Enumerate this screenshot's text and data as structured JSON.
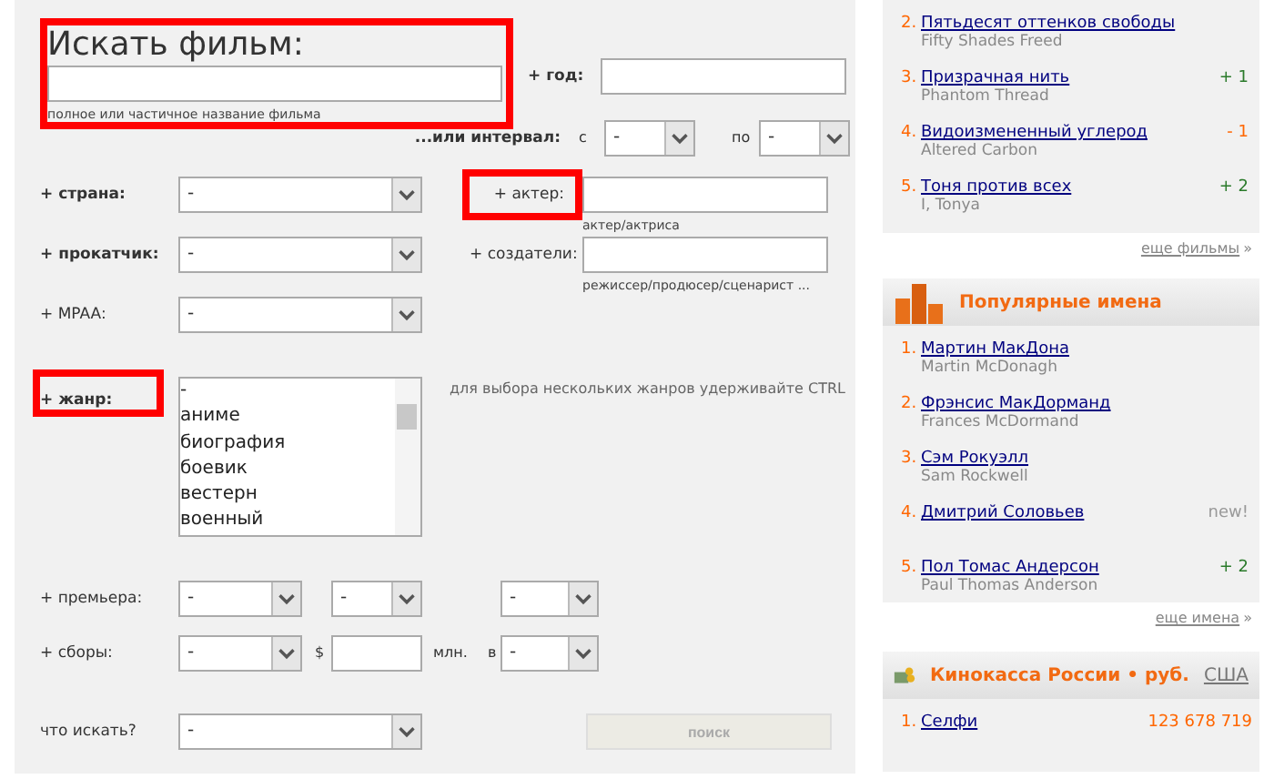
{
  "search": {
    "title": "Искать фильм:",
    "title_highlighted": true,
    "hint": "полное или частичное название фильма",
    "year_label": "+ год:",
    "interval_label": "...или интервал:",
    "from_label": "с",
    "from_value": "-",
    "to_label": "по",
    "to_value": "-"
  },
  "fields": [
    {
      "label": "+ страна:",
      "bold": true,
      "value": "-",
      "side_label": "+ актер:",
      "side_highlighted": true,
      "side_hint": "актер/актриса"
    },
    {
      "label": "+ прокатчик:",
      "bold": true,
      "value": "-",
      "side_label": "+ создатели:",
      "side_highlighted": false,
      "side_hint": "режиссер/продюсер/сценарист ..."
    },
    {
      "label": "+ MPAA:",
      "bold": false,
      "value": "-"
    }
  ],
  "genre": {
    "label": "+ жанр:",
    "highlighted": true,
    "options": [
      "-",
      "аниме",
      "биография",
      "боевик",
      "вестерн",
      "военный"
    ],
    "hint": "для выбора нескольких жанров удерживайте CTRL"
  },
  "premiere": {
    "label": "+ премьера:",
    "values": [
      "-",
      "-",
      "-"
    ]
  },
  "gross": {
    "label": "+ сборы:",
    "value": "-",
    "currency": "$",
    "unit": "млн.",
    "in_label": "в",
    "in_value": "-"
  },
  "what": {
    "label": "что искать?",
    "value": "-",
    "button": "поиск",
    "button_disabled": true
  },
  "top_films": {
    "items": [
      {
        "rank": "2.",
        "title": "Пятьдесят оттенков свободы",
        "original": "Fifty Shades Freed"
      },
      {
        "rank": "3.",
        "title": "Призрачная нить",
        "original": "Phantom Thread",
        "change": "+ 1",
        "kind": "up"
      },
      {
        "rank": "4.",
        "title": "Видоизмененный углерод",
        "original": "Altered Carbon",
        "change": "- 1",
        "kind": "down"
      },
      {
        "rank": "5.",
        "title": "Тоня против всех",
        "original": "I, Tonya",
        "change": "+ 2",
        "kind": "up"
      }
    ],
    "more": "еще фильмы",
    "more_arrow": "»"
  },
  "popular_names": {
    "title": "Популярные имена",
    "items": [
      {
        "rank": "1.",
        "title": "Мартин МакДона",
        "original": "Martin McDonagh"
      },
      {
        "rank": "2.",
        "title": "Фрэнсис МакДорманд",
        "original": "Frances McDormand"
      },
      {
        "rank": "3.",
        "title": "Сэм Рокуэлл",
        "original": "Sam Rockwell"
      },
      {
        "rank": "4.",
        "title": "Дмитрий Соловьев",
        "change": "new!",
        "kind": "new"
      },
      {
        "rank": "5.",
        "title": "Пол Томас Андерсон",
        "original": "Paul Thomas Anderson",
        "change": "+ 2",
        "kind": "up"
      }
    ],
    "more": "еще имена",
    "more_arrow": "»"
  },
  "box_office": {
    "title": "Кинокасса России • руб.",
    "tab": "США",
    "items": [
      {
        "rank": "1.",
        "title": "Селфи",
        "amount": "123 678 719"
      }
    ]
  }
}
